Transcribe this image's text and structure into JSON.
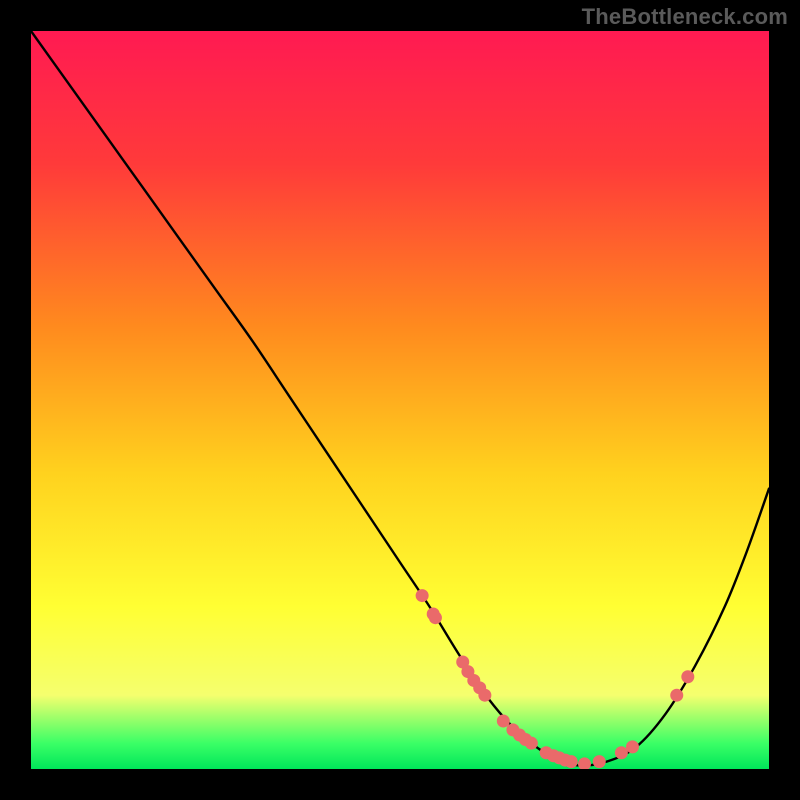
{
  "watermark": "TheBottleneck.com",
  "chart_data": {
    "type": "line",
    "title": "",
    "xlabel": "",
    "ylabel": "",
    "xlim": [
      0,
      100
    ],
    "ylim": [
      0,
      100
    ],
    "gradient_stops": [
      {
        "offset": 0.0,
        "color": "#ff1a52"
      },
      {
        "offset": 0.18,
        "color": "#ff3a3a"
      },
      {
        "offset": 0.4,
        "color": "#ff8a1e"
      },
      {
        "offset": 0.6,
        "color": "#ffd21e"
      },
      {
        "offset": 0.78,
        "color": "#ffff33"
      },
      {
        "offset": 0.9,
        "color": "#f5ff6e"
      },
      {
        "offset": 0.965,
        "color": "#3bff66"
      },
      {
        "offset": 1.0,
        "color": "#00e65a"
      }
    ],
    "curve": {
      "x": [
        0,
        5,
        10,
        15,
        20,
        25,
        30,
        35,
        40,
        45,
        50,
        54,
        58,
        62,
        66,
        70,
        74,
        78,
        82,
        86,
        90,
        94,
        97,
        100
      ],
      "y": [
        100,
        93,
        86,
        79,
        72,
        65,
        58,
        50.5,
        43,
        35.5,
        28,
        22,
        15.5,
        9.5,
        5,
        2,
        0.5,
        1,
        3,
        7.5,
        14,
        22,
        29.5,
        38
      ]
    },
    "markers": [
      {
        "x": 53.0,
        "y": 23.5
      },
      {
        "x": 54.5,
        "y": 21.0
      },
      {
        "x": 54.8,
        "y": 20.5
      },
      {
        "x": 58.5,
        "y": 14.5
      },
      {
        "x": 59.2,
        "y": 13.2
      },
      {
        "x": 60.0,
        "y": 12.0
      },
      {
        "x": 60.8,
        "y": 11.0
      },
      {
        "x": 61.5,
        "y": 10.0
      },
      {
        "x": 64.0,
        "y": 6.5
      },
      {
        "x": 65.3,
        "y": 5.3
      },
      {
        "x": 66.2,
        "y": 4.6
      },
      {
        "x": 67.0,
        "y": 4.0
      },
      {
        "x": 67.8,
        "y": 3.5
      },
      {
        "x": 69.8,
        "y": 2.2
      },
      {
        "x": 70.8,
        "y": 1.8
      },
      {
        "x": 71.6,
        "y": 1.5
      },
      {
        "x": 72.4,
        "y": 1.2
      },
      {
        "x": 73.2,
        "y": 1.0
      },
      {
        "x": 75.0,
        "y": 0.7
      },
      {
        "x": 77.0,
        "y": 1.0
      },
      {
        "x": 80.0,
        "y": 2.2
      },
      {
        "x": 81.5,
        "y": 3.0
      },
      {
        "x": 87.5,
        "y": 10.0
      },
      {
        "x": 89.0,
        "y": 12.5
      }
    ],
    "marker_color": "#ea6a6a",
    "curve_color": "#000000"
  }
}
